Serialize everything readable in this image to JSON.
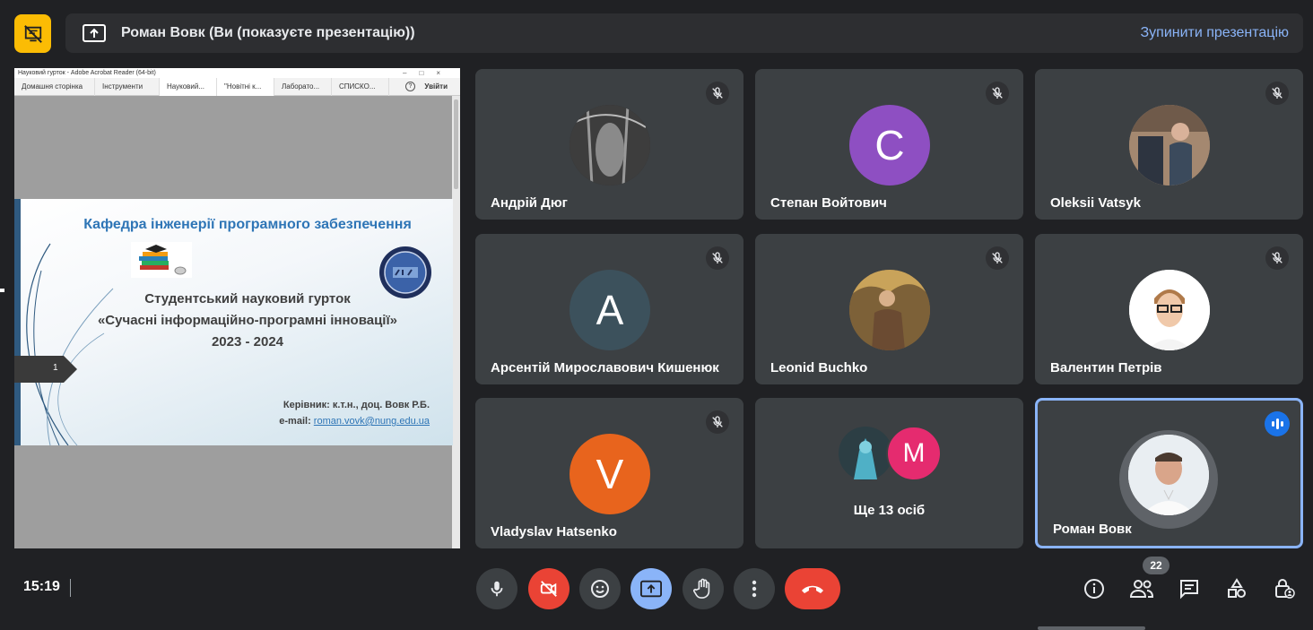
{
  "header": {
    "presenter_title": "Роман Вовк (Ви (показуєте презентацію))",
    "stop_presenting": "Зупинити презентацію"
  },
  "acrobat": {
    "window_title": "Науковий гурток - Adobe Acrobat Reader (64-bit)",
    "tabs": [
      "Домашня сторінка",
      "Інструменти",
      "Науковий...",
      "\"Новітні к...",
      "Лаборато...",
      "СПИСКО..."
    ],
    "login": "Увійти"
  },
  "slide": {
    "title": "Кафедра інженерії програмного забезпечення",
    "subtitle_1": "Студентський науковий гурток",
    "subtitle_2": "«Сучасні інформаційно-програмні інновації»",
    "years": "2023 - 2024",
    "leader": "Керівник: к.т.н., доц. Вовк Р.Б.",
    "email_label": "e-mail: ",
    "email": "roman.vovk@nung.edu.ua",
    "page_number": "1"
  },
  "participants": [
    {
      "name": "Андрій Дюг",
      "type": "photo"
    },
    {
      "name": "Степан Войтович",
      "initial": "С",
      "color": "#8e4fc2"
    },
    {
      "name": "Oleksii Vatsyk",
      "type": "photo"
    },
    {
      "name": "Арсентій Мирославович Кишенюк",
      "initial": "A",
      "color": "#3c515c"
    },
    {
      "name": "Leonid Buchko",
      "type": "photo"
    },
    {
      "name": "Валентин Петрів",
      "type": "photo"
    },
    {
      "name": "Vladyslav Hatsenko",
      "initial": "V",
      "color": "#e8641d"
    },
    {
      "name": "Роман Вовк",
      "type": "photo"
    }
  ],
  "more_tile": {
    "label": "Ще 13 осіб",
    "initial": "M",
    "color": "#e52b6f"
  },
  "controls": {
    "time": "15:19",
    "participant_count": "22"
  },
  "colors": {
    "accent_blue": "#8ab4f8",
    "danger_red": "#ea4335",
    "warning_yellow": "#fbbc04"
  }
}
